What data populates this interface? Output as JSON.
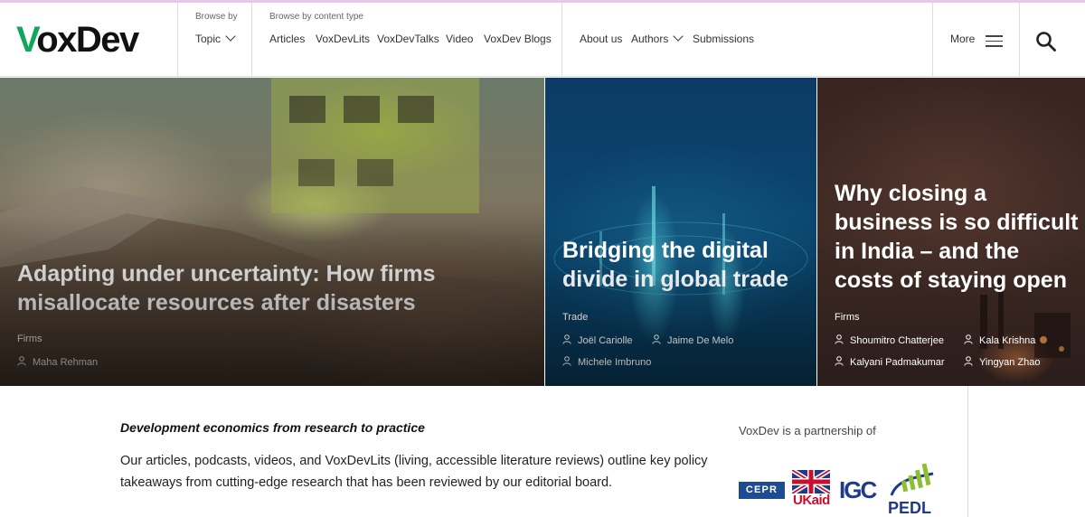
{
  "brand": {
    "logo_first": "V",
    "logo_rest": "oxDev",
    "accent": "#12a65a"
  },
  "nav": {
    "browse_by_label": "Browse by",
    "topic_label": "Topic",
    "content_type_label": "Browse by content type",
    "content_types": [
      "Articles",
      "VoxDevLits",
      "VoxDevTalks",
      "Video",
      "VoxDev Blogs"
    ],
    "about_label": "About us",
    "authors_label": "Authors",
    "submissions_label": "Submissions",
    "more_label": "More"
  },
  "hero": [
    {
      "title": "Adapting under uncertainty: How firms misallocate resources after disasters",
      "category": "Firms",
      "authors": [
        "Maha Rehman"
      ]
    },
    {
      "title": "Bridging the digital divide in global trade",
      "category": "Trade",
      "authors": [
        "Joël Cariolle",
        "Jaime De Melo",
        "Michele Imbruno"
      ]
    },
    {
      "title": "Why closing a business is so difficult in India – and the costs of staying open",
      "category": "Firms",
      "authors": [
        "Shoumitro Chatterjee",
        "Kala Krishna",
        "Kalyani Padmakumar",
        "Yingyan Zhao"
      ]
    }
  ],
  "intro": {
    "tagline": "Development economics from research to practice",
    "description": "Our articles, podcasts, videos, and VoxDevLits (living, accessible literature reviews) outline key policy takeaways from cutting-edge research that has been reviewed by our editorial board."
  },
  "partners": {
    "label": "VoxDev is a partnership of",
    "logos": [
      {
        "name": "cepr-logo",
        "text": "CEPR"
      },
      {
        "name": "ukaid-logo",
        "text": "UKaid"
      },
      {
        "name": "igc-logo",
        "text": "IGC"
      },
      {
        "name": "pedl-logo",
        "text": "PEDL"
      }
    ]
  },
  "icons": {
    "menu": "hamburger-icon",
    "search": "search-icon",
    "author": "person-icon",
    "dropdown": "chevron-down-icon"
  }
}
